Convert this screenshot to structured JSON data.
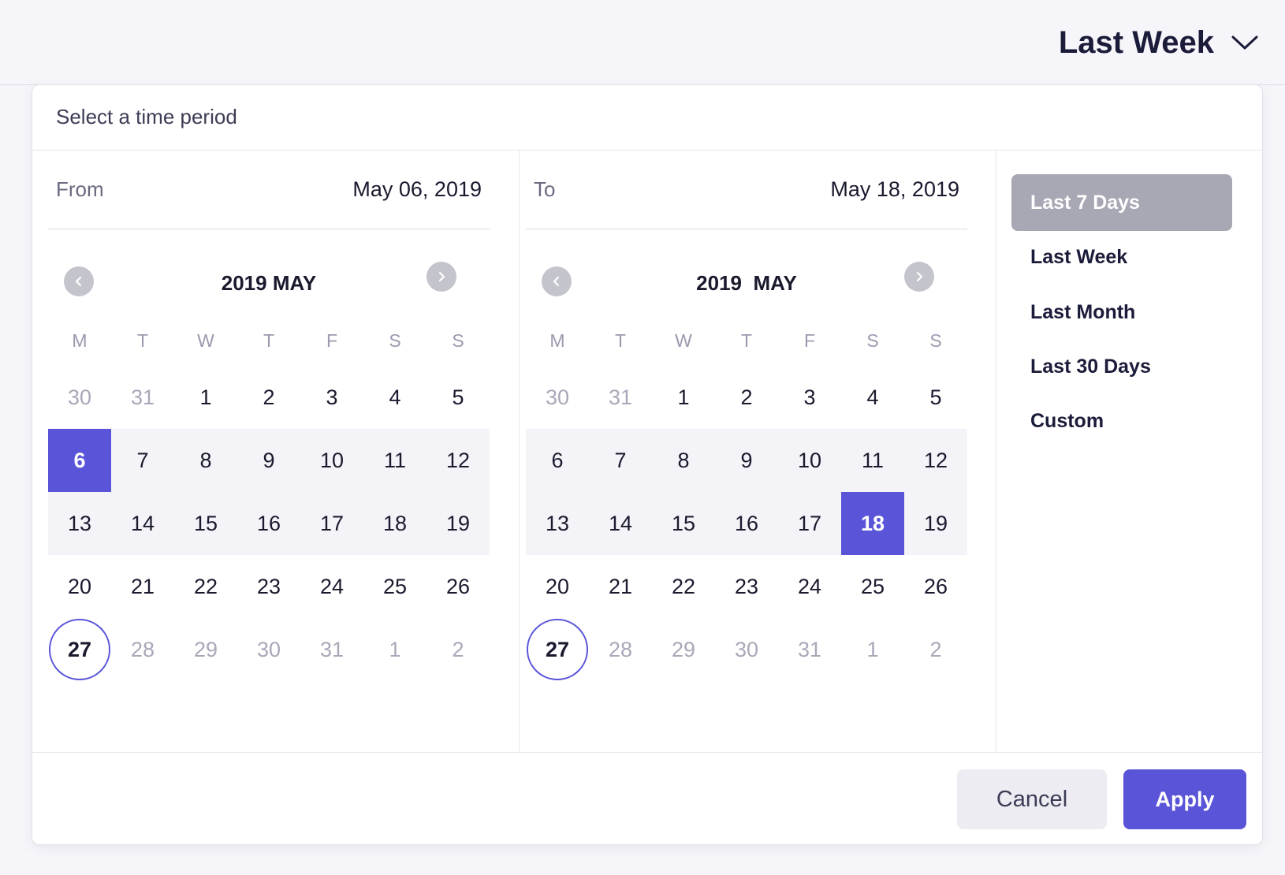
{
  "header": {
    "period_label": "Last Week"
  },
  "panel": {
    "title": "Select a time period"
  },
  "from": {
    "label": "From",
    "date": "May 06, 2019",
    "month_title": "2019 MAY",
    "weekdays": [
      "M",
      "T",
      "W",
      "T",
      "F",
      "S",
      "S"
    ],
    "weeks": [
      [
        "30",
        "31",
        "1",
        "2",
        "3",
        "4",
        "5"
      ],
      [
        "6",
        "7",
        "8",
        "9",
        "10",
        "11",
        "12"
      ],
      [
        "13",
        "14",
        "15",
        "16",
        "17",
        "18",
        "19"
      ],
      [
        "20",
        "21",
        "22",
        "23",
        "24",
        "25",
        "26"
      ],
      [
        "27",
        "28",
        "29",
        "30",
        "31",
        "1",
        "2"
      ]
    ]
  },
  "to": {
    "label": "To",
    "date": "May 18, 2019",
    "month_title": "2019  MAY",
    "weekdays": [
      "M",
      "T",
      "W",
      "T",
      "F",
      "S",
      "S"
    ],
    "weeks": [
      [
        "30",
        "31",
        "1",
        "2",
        "3",
        "4",
        "5"
      ],
      [
        "6",
        "7",
        "8",
        "9",
        "10",
        "11",
        "12"
      ],
      [
        "13",
        "14",
        "15",
        "16",
        "17",
        "18",
        "19"
      ],
      [
        "20",
        "21",
        "22",
        "23",
        "24",
        "25",
        "26"
      ],
      [
        "27",
        "28",
        "29",
        "30",
        "31",
        "1",
        "2"
      ]
    ]
  },
  "presets": [
    "Last 7 Days",
    "Last Week",
    "Last Month",
    "Last 30 Days",
    "Custom"
  ],
  "active_preset": "Last 7 Days",
  "buttons": {
    "cancel": "Cancel",
    "apply": "Apply"
  },
  "colors": {
    "accent": "#5a55d8",
    "range": "#f3f3f8",
    "preset_active": "#a8a8b4"
  }
}
